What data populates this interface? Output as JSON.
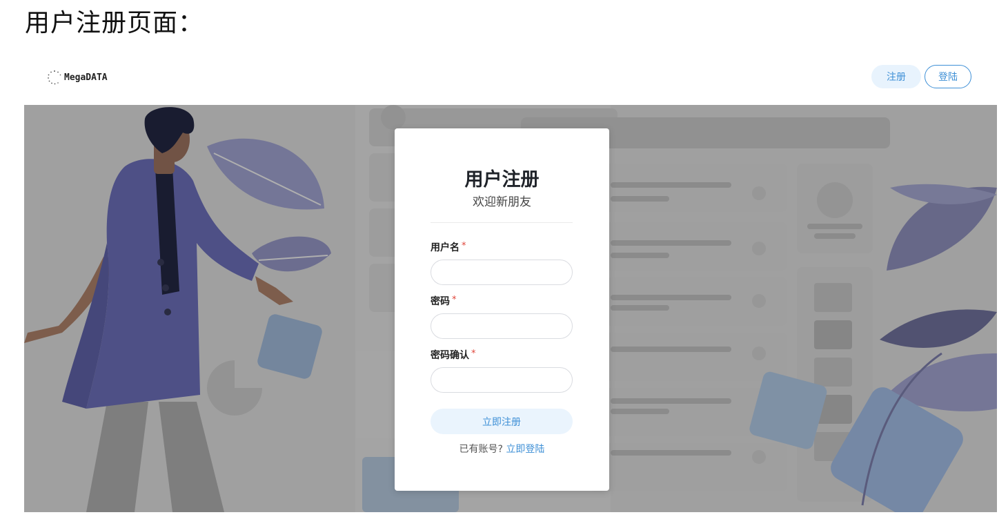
{
  "caption": "用户注册页面：",
  "header": {
    "logo_text": "MegaDATA",
    "logo_icon": "dotted-circle-logo-icon",
    "register_label": "注册",
    "login_label": "登陆"
  },
  "card": {
    "title": "用户注册",
    "subtitle": "欢迎新朋友",
    "fields": [
      {
        "label": "用户名",
        "required_mark": "*",
        "value": "",
        "placeholder": ""
      },
      {
        "label": "密码",
        "required_mark": "*",
        "value": "",
        "placeholder": ""
      },
      {
        "label": "密码确认",
        "required_mark": "*",
        "value": "",
        "placeholder": ""
      }
    ],
    "submit_label": "立即注册",
    "has_account_text": "已有账号?",
    "login_link_text": "立即登陆"
  },
  "colors": {
    "accent": "#3d8fd6",
    "accent_light": "#e8f3fd",
    "required": "#e0463b",
    "figure_coat": "#5b5ea6"
  }
}
